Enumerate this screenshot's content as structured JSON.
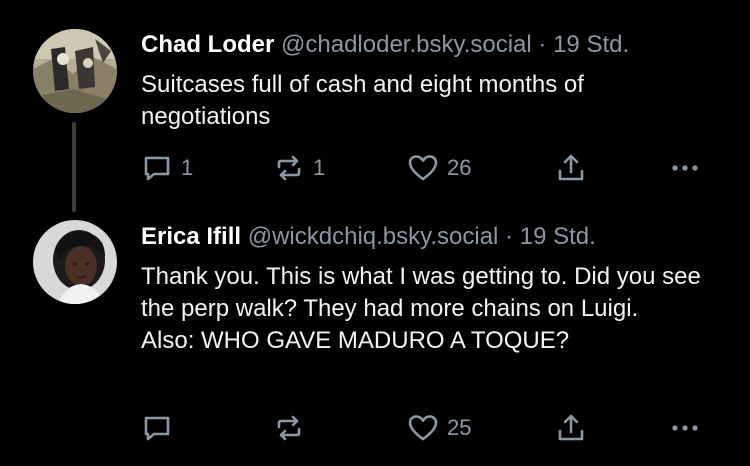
{
  "posts": [
    {
      "author_name": "Chad Loder",
      "handle": "@chadloder.bsky.social",
      "separator": "·",
      "time": "19 Std.",
      "text_lines": [
        "Suitcases full of cash and eight months of negotiations"
      ],
      "counts": {
        "reply": "1",
        "repost": "1",
        "like": "26"
      }
    },
    {
      "author_name": "Erica Ifill",
      "handle": "@wickdchiq.bsky.social",
      "separator": "·",
      "time": "19 Std.",
      "text_lines": [
        "Thank you. This is what I was getting to. Did you see the perp walk? They had more chains on Luigi.",
        "Also: WHO GAVE MADURO A TOQUE?"
      ],
      "counts": {
        "reply": "",
        "repost": "",
        "like": "25"
      }
    }
  ],
  "icons": {
    "reply": "speech-bubble-icon",
    "repost": "repost-arrows-icon",
    "like": "heart-icon",
    "share": "share-upload-icon",
    "more": "ellipsis-icon"
  },
  "colors": {
    "background": "#000000",
    "text": "#f1f3f5",
    "muted": "#8c97a6",
    "thread_line": "#3a3f45"
  }
}
